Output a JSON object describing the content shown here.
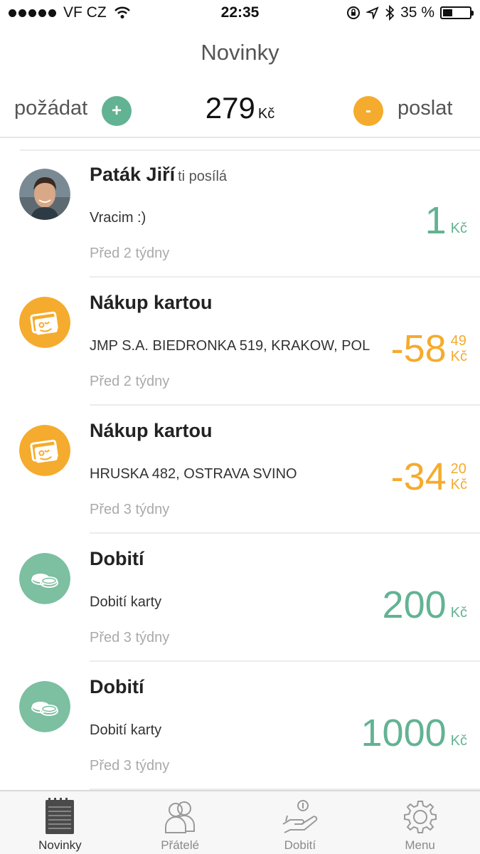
{
  "status_bar": {
    "carrier": "VF CZ",
    "time": "22:35",
    "battery_percent": "35 %",
    "battery_level": 0.35
  },
  "header": {
    "title": "Novinky"
  },
  "balance_bar": {
    "request_label": "požádat",
    "plus_symbol": "+",
    "balance_amount": "279",
    "balance_currency": "Kč",
    "minus_symbol": "-",
    "send_label": "poslat"
  },
  "colors": {
    "green": "#62b393",
    "orange": "#f5ab2d"
  },
  "feed": [
    {
      "icon": "avatar",
      "name": "Paták Jiří",
      "sub": "ti posílá",
      "desc": "Vracim :)",
      "time": "Před 2 týdny",
      "amount": "1",
      "cents": "",
      "currency": "Kč",
      "color": "green"
    },
    {
      "icon": "card-icon",
      "name": "Nákup kartou",
      "sub": "",
      "desc": "JMP S.A. BIEDRONKA 519, KRAKOW, POL",
      "time": "Před 2 týdny",
      "amount": "-58",
      "cents": "49",
      "currency": "Kč",
      "color": "orange"
    },
    {
      "icon": "card-icon",
      "name": "Nákup kartou",
      "sub": "",
      "desc": "HRUSKA 482, OSTRAVA SVINO",
      "time": "Před 3 týdny",
      "amount": "-34",
      "cents": "20",
      "currency": "Kč",
      "color": "orange"
    },
    {
      "icon": "coins-icon",
      "name": "Dobití",
      "sub": "",
      "desc": "Dobití karty",
      "time": "Před 3 týdny",
      "amount": "200",
      "cents": "",
      "currency": "Kč",
      "color": "green"
    },
    {
      "icon": "coins-icon",
      "name": "Dobití",
      "sub": "",
      "desc": "Dobití karty",
      "time": "Před 3 týdny",
      "amount": "1000",
      "cents": "",
      "currency": "Kč",
      "color": "green"
    }
  ],
  "tabs": [
    {
      "label": "Novinky",
      "icon": "notepad-icon",
      "active": true
    },
    {
      "label": "Přátelé",
      "icon": "friends-icon",
      "active": false
    },
    {
      "label": "Dobití",
      "icon": "topup-icon",
      "active": false
    },
    {
      "label": "Menu",
      "icon": "gear-icon",
      "active": false
    }
  ]
}
